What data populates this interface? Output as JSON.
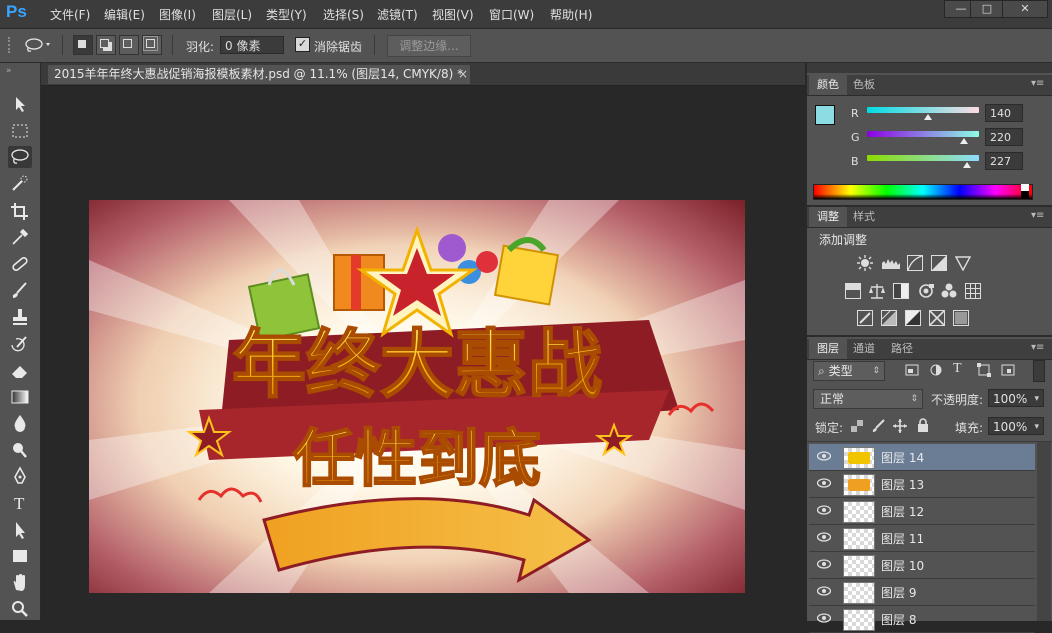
{
  "app": {
    "logo": "Ps"
  },
  "menu": [
    "文件(F)",
    "编辑(E)",
    "图像(I)",
    "图层(L)",
    "类型(Y)",
    "选择(S)",
    "滤镜(T)",
    "视图(V)",
    "窗口(W)",
    "帮助(H)"
  ],
  "window_controls": {
    "minimize": "—",
    "maximize": "□",
    "close": "✕"
  },
  "options_bar": {
    "feather_label": "羽化:",
    "feather_value": "0 像素",
    "antialias_label": "消除锯齿",
    "antialias_checked": true,
    "refine_edge_label": "调整边缘..."
  },
  "tools": [
    "move-icon",
    "marquee-icon",
    "lasso-icon",
    "quick-select-icon",
    "crop-icon",
    "eyedropper-icon",
    "healing-brush-icon",
    "brush-icon",
    "stamp-icon",
    "history-brush-icon",
    "eraser-icon",
    "gradient-icon",
    "blur-icon",
    "dodge-icon",
    "pen-icon",
    "type-icon",
    "path-select-icon",
    "shape-icon",
    "hand-icon",
    "zoom-icon"
  ],
  "document_tab": {
    "title": "2015羊年年终大惠战促销海报模板素材.psd @ 11.1% (图层14, CMYK/8) *",
    "close": "×"
  },
  "artwork": {
    "line1": "年终大惠战",
    "line2": "任性到底"
  },
  "color_panel": {
    "tabs": [
      "颜色",
      "色板"
    ],
    "swatch_color": "#8cdce3",
    "r_label": "R",
    "g_label": "G",
    "b_label": "B",
    "r": "140",
    "g": "220",
    "b": "227",
    "r_fraction": 0.549,
    "g_fraction": 0.863,
    "b_fraction": 0.89
  },
  "adjustments_panel": {
    "tabs": [
      "调整",
      "样式"
    ],
    "title": "添加调整",
    "icons": [
      "brightness-icon",
      "levels-icon",
      "curves-icon",
      "exposure-icon",
      "vibrance-icon",
      "hue-saturation-icon",
      "color-balance-icon",
      "black-white-icon",
      "photo-filter-icon",
      "channel-mixer-icon",
      "color-lookup-icon",
      "invert-icon",
      "posterize-icon",
      "threshold-icon",
      "selective-color-icon",
      "gradient-map-icon"
    ]
  },
  "layers_panel": {
    "tabs": [
      "图层",
      "通道",
      "路径"
    ],
    "filter_kind": "类型",
    "blend_mode": "正常",
    "opacity_label": "不透明度:",
    "opacity_value": "100%",
    "lock_label": "锁定:",
    "fill_label": "填充:",
    "fill_value": "100%",
    "layers": [
      {
        "name": "图层 14",
        "selected": true
      },
      {
        "name": "图层 13",
        "selected": false
      },
      {
        "name": "图层 12",
        "selected": false
      },
      {
        "name": "图层 11",
        "selected": false
      },
      {
        "name": "图层 10",
        "selected": false
      },
      {
        "name": "图层 9",
        "selected": false
      },
      {
        "name": "图层 8",
        "selected": false
      }
    ]
  }
}
